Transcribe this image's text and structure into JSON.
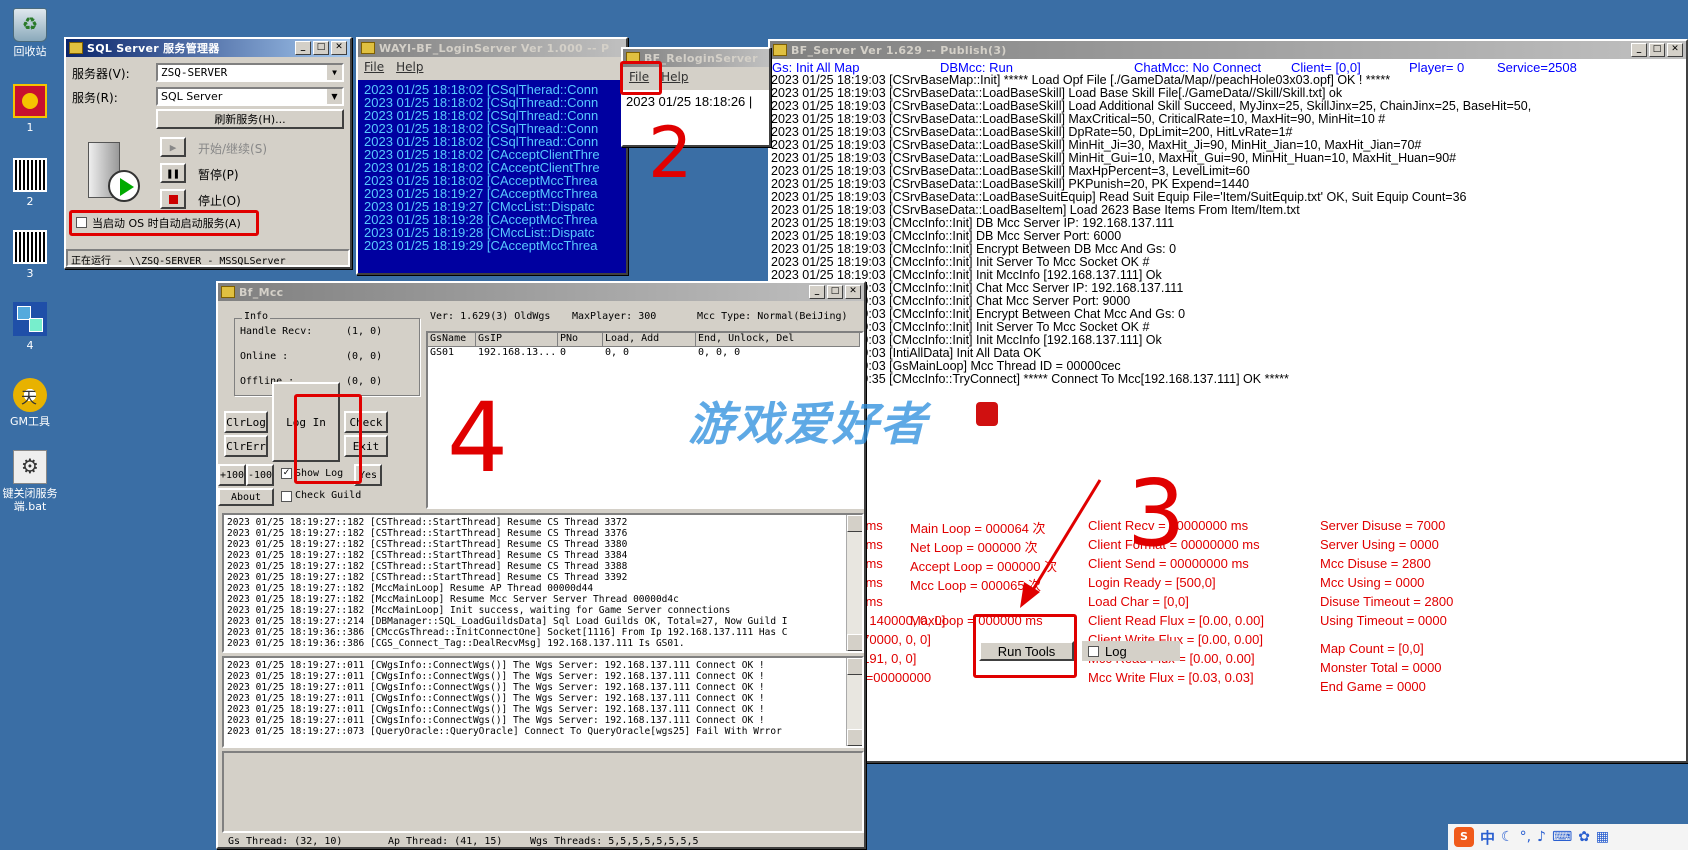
{
  "desktop": {
    "icons": [
      {
        "label": "回收站",
        "kind": "bin"
      },
      {
        "label": "1",
        "kind": "tiger"
      },
      {
        "label": "2",
        "kind": "bar"
      },
      {
        "label": "3",
        "kind": "bar"
      },
      {
        "label": "4",
        "kind": "cube"
      },
      {
        "label": "GM工具",
        "kind": "gm"
      },
      {
        "label": "键关闭服务端.bat",
        "kind": "bat"
      }
    ]
  },
  "sqlsm": {
    "title": "SQL Server 服务管理器",
    "server_label": "服务器(V):",
    "server_value": "ZSQ-SERVER",
    "service_label": "服务(R):",
    "service_value": "SQL Server",
    "refresh": "刷新服务(H)...",
    "start": "开始/继续(S)",
    "pause": "暂停(P)",
    "stop": "停止(O)",
    "autostart": "当启动 OS 时自动启动服务(A)",
    "status": "正在运行 - \\\\ZSQ-SERVER - MSSQLServer"
  },
  "login": {
    "title": "WAYI-BF_LoginServer Ver 1.000 -- P",
    "menu": [
      "File",
      "Help"
    ],
    "lines": [
      "2023 01/25 18:18:02 [CSqlTherad::Conn",
      "2023 01/25 18:18:02 [CSqlThread::Conn",
      "2023 01/25 18:18:02 [CSqlThread::Conn",
      "2023 01/25 18:18:02 [CSqlThread::Conn",
      "2023 01/25 18:18:02 [CSqlThread::Conn",
      "2023 01/25 18:18:02 [CAcceptClientThre",
      "2023 01/25 18:18:02 [CAcceptClientThre",
      "2023 01/25 18:18:02 [CAcceptMccThrea",
      "2023 01/25 18:19:27 [CAcceptMccThrea",
      "2023 01/25 18:19:27 [CMccList::Dispatc",
      "2023 01/25 18:19:28 [CAcceptMccThrea",
      "2023 01/25 18:19:28 [CMccList::Dispatc",
      "2023 01/25 18:19:29 [CAcceptMccThrea"
    ]
  },
  "relogin": {
    "title": "BF_ReloginServer",
    "menu": [
      "File",
      "Help"
    ],
    "line": "2023 01/25 18:18:26 |"
  },
  "bfserver": {
    "title": "BF_Server Ver 1.629 -- Publish(3)",
    "header": [
      {
        "l": "Gs: Init All Map"
      },
      {
        "l": "DBMcc:  Run"
      },
      {
        "l": "ChatMcc:  No Connect"
      },
      {
        "l": "Client= [0,0]"
      },
      {
        "l": "Player= 0"
      },
      {
        "l": "Service=2508"
      }
    ],
    "lines": [
      "2023 01/25 18:19:03 [CSrvBaseMap::Init] ***** Load Opf File [./GameData/Map//peachHole03x03.opf] OK ! *****",
      "2023 01/25 18:19:03 [CSrvBaseData::LoadBaseSkill] Load Base Skill File[./GameData//Skill/Skill.txt] ok",
      "2023 01/25 18:19:03 [CSrvBaseData::LoadBaseSkill] Load Additional Skill Succeed, MyJinx=25, SkillJinx=25, ChainJinx=25, BaseHit=50,",
      "2023 01/25 18:19:03 [CSrvBaseData::LoadBaseSkill] MaxCritical=50, CriticalRate=10, MaxHit=90, MinHit=10 #",
      "2023 01/25 18:19:03 [CSrvBaseData::LoadBaseSkill] DpRate=50, DpLimit=200, HitLvRate=1#",
      "2023 01/25 18:19:03 [CSrvBaseData::LoadBaseSkill] MinHit_Ji=30, MaxHit_Ji=90, MinHit_Jian=10, MaxHit_Jian=70#",
      "2023 01/25 18:19:03 [CSrvBaseData::LoadBaseSkill] MinHit_Gui=10, MaxHit_Gui=90, MinHit_Huan=10, MaxHit_Huan=90#",
      "2023 01/25 18:19:03 [CSrvBaseData::LoadBaseSkill] MaxHpPercent=3, LevelLimit=60",
      "2023 01/25 18:19:03 [CSrvBaseData::LoadBaseSkill] PKPunish=20, PK Expend=1440",
      "2023 01/25 18:19:03 [CSrvBaseData::LoadBaseSuitEquip] Read Suit Equip File='Item/SuitEquip.txt' OK, Suit Equip Count=36",
      "2023 01/25 18:19:03 [CSrvBaseData::LoadBaseItem] Load 2623 Base Items From Item/Item.txt",
      "2023 01/25 18:19:03 [CMccInfo::Init] DB Mcc Server IP: 192.168.137.111",
      "2023 01/25 18:19:03 [CMccInfo::Init] DB Mcc Server Port: 6000",
      "2023 01/25 18:19:03 [CMccInfo::Init] Encrypt Between DB Mcc And Gs: 0",
      "2023 01/25 18:19:03 [CMccInfo::Init] Init Server To Mcc Socket OK #",
      "2023 01/25 18:19:03 [CMccInfo::Init] Init MccInfo [192.168.137.111] Ok",
      "2023 01/25 18:19:03 [CMccInfo::Init] Chat Mcc Server IP: 192.168.137.111",
      "2023 01/25 18:19:03 [CMccInfo::Init] Chat Mcc Server Port: 9000",
      "2023 01/25 18:19:03 [CMccInfo::Init] Encrypt Between Chat Mcc And Gs: 0",
      "2023 01/25 18:19:03 [CMccInfo::Init] Init Server To Mcc Socket OK #",
      "2023 01/25 18:19:03 [CMccInfo::Init] Init MccInfo [192.168.137.111] Ok",
      "2023 01/25 18:19:03 [IntiAllData] Init All Data OK",
      "2023 01/25 18:19:03 [GsMainLoop] Mcc Thread ID = 00000cec",
      "2023 01/25 18:19:35 [CMccInfo::TryConnect] ***** Connect To Mcc[192.168.137.111] OK *****"
    ],
    "stats_col1": [
      "00000000 ms",
      "00000000 ms",
      "00000000 ms",
      "00000000 ms",
      "00000000 ms",
      "= [140000, 140000, 0, 0]",
      "= [70000, 70000, 0, 0]",
      "= [8191, 8191, 0, 0]",
      "00  RfhTick=00000000"
    ],
    "stats_col2": [
      "Main Loop    = 000064 次",
      "Net Loop     = 000000 次",
      "Accept Loop = 000000 次",
      "Mcc Loop     = 000065 次"
    ],
    "run_tools": "Run Tools",
    "log_label": "Log",
    "maxloop": "MaxLoop = 000000 ms",
    "stats_col3": [
      "Client Recv     = 00000000 ms",
      "Client Format  = 00000000 ms",
      "Client Send     = 00000000 ms",
      "Login Ready    = [500,0]",
      "Load Char       = [0,0]",
      "Client Read Flux = [0.00, 0.00]",
      "Client Write Flux = [0.00, 0.00]",
      "Mcc Read Flux    = [0.00, 0.00]",
      "Mcc Write Flux    = [0.03, 0.03]"
    ],
    "stats_col4": [
      "Server Disuse    = 7000",
      "Server Using      = 0000",
      "Mcc Disuse        = 2800",
      "Mcc Using          = 0000",
      "Disuse Timeout = 2800",
      "Using Timeout    = 0000",
      "",
      "Map Count         = [0,0]",
      "Monster Total     = 0000",
      "End Game          = 0000"
    ]
  },
  "mcc": {
    "title": "Bf_Mcc",
    "info_label": "Info",
    "info": [
      {
        "k": "Handle Recv:",
        "v": "(1, 0)"
      },
      {
        "k": "Online :",
        "v": "(0, 0)"
      },
      {
        "k": "Offline :",
        "v": "(0, 0)"
      }
    ],
    "ver": "Ver: 1.629(3) OldWgs",
    "maxplayer": "MaxPlayer: 300",
    "mcctype": "Mcc Type: Normal(BeiJing)",
    "table_headers": [
      "GsName",
      "GsIP",
      "PNo",
      "Load, Add",
      "End, Unlock, Del"
    ],
    "table_rows": [
      [
        "GS01",
        "192.168.13...",
        "0",
        "0, 0",
        "0, 0, 0"
      ]
    ],
    "btn": {
      "clrlog": "ClrLog",
      "clrerr": "ClrErr",
      "login": "Log In",
      "check": "Check",
      "exit": "Exit",
      "p100": "+100",
      "m100": "-100",
      "showlog": "Show Log",
      "yes": "Yes",
      "about": "About",
      "checkguild": "Check Guild"
    },
    "log1": [
      "2023 01/25 18:19:27::182 [CSThread::StartThread] Resume CS Thread 3372",
      "2023 01/25 18:19:27::182 [CSThread::StartThread] Resume CS Thread 3376",
      "2023 01/25 18:19:27::182 [CSThread::StartThread] Resume CS Thread 3380",
      "2023 01/25 18:19:27::182 [CSThread::StartThread] Resume CS Thread 3384",
      "2023 01/25 18:19:27::182 [CSThread::StartThread] Resume CS Thread 3388",
      "2023 01/25 18:19:27::182 [CSThread::StartThread] Resume CS Thread 3392",
      "2023 01/25 18:19:27::182 [MccMainLoop] Resume AP Thread 00000d44",
      "2023 01/25 18:19:27::182 [MccMainLoop] Resume Mcc Server Server Thread 00000d4c",
      "2023 01/25 18:19:27::182 [MccMainLoop] Init success, waiting for Game Server connections",
      "2023 01/25 18:19:27::214 [DBManager::SQL_LoadGuildsData] Sql Load Guilds OK, Total=27, Now Guild I",
      "2023 01/25 18:19:36::386 [CMccGsThread::InitConnectOne] Socket[1116] From Ip 192.168.137.111 Has C",
      "2023 01/25 18:19:36::386 [CGS_Connect_Tag::DealRecvMsg] 192.168.137.111 Is GS01."
    ],
    "log2": [
      "2023 01/25 18:19:27::011 [CWgsInfo::ConnectWgs()] The Wgs Server: 192.168.137.111 Connect OK !",
      "2023 01/25 18:19:27::011 [CWgsInfo::ConnectWgs()] The Wgs Server: 192.168.137.111 Connect OK !",
      "2023 01/25 18:19:27::011 [CWgsInfo::ConnectWgs()] The Wgs Server: 192.168.137.111 Connect OK !",
      "2023 01/25 18:19:27::011 [CWgsInfo::ConnectWgs()] The Wgs Server: 192.168.137.111 Connect OK !",
      "2023 01/25 18:19:27::011 [CWgsInfo::ConnectWgs()] The Wgs Server: 192.168.137.111 Connect OK !",
      "2023 01/25 18:19:27::011 [CWgsInfo::ConnectWgs()] The Wgs Server: 192.168.137.111 Connect OK !",
      "2023 01/25 18:19:27::073 [QueryOracle::QueryOracle] Connect To QueryOracle[wgs25] Fail With Wrror"
    ],
    "status": {
      "gs": "Gs Thread:  (32, 10)",
      "ap": "Ap Thread:  (41, 15)",
      "wgs": "Wgs Threads: 5,5,5,5,5,5,5,5"
    }
  },
  "annotations": [
    "2",
    "3",
    "4"
  ],
  "watermark": "游戏爱好者",
  "tray": [
    "S",
    "中"
  ]
}
